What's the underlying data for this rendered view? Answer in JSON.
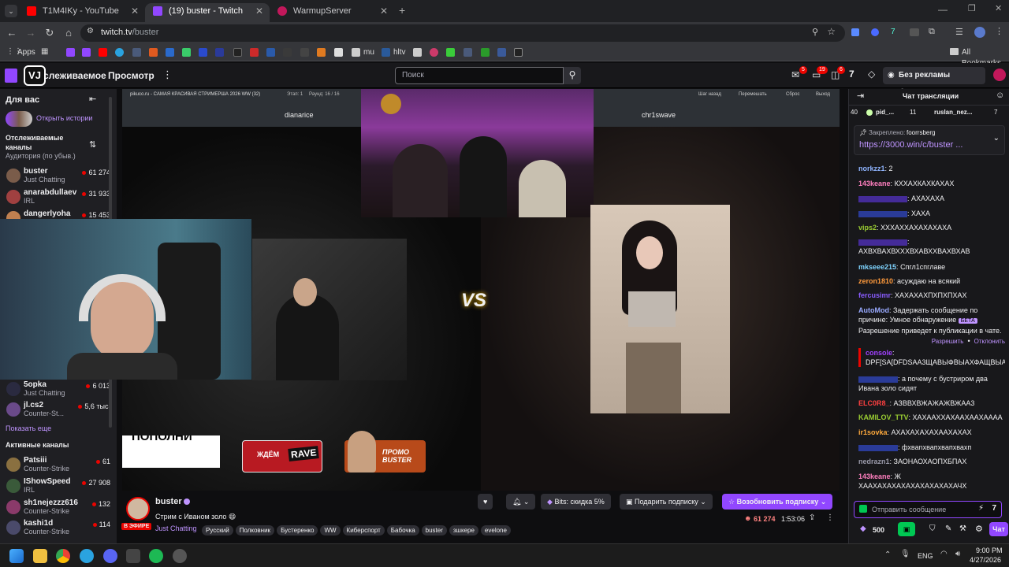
{
  "browser": {
    "tabs": [
      {
        "title": "T1M4IKy - YouTube",
        "active": false,
        "color": "#ff0000"
      },
      {
        "title": "(19) buster - Twitch",
        "active": true,
        "color": "#9147ff"
      },
      {
        "title": "WarmupServer",
        "active": false,
        "color": "#c2185b"
      }
    ],
    "url_host": "twitch.tv",
    "url_path": "/buster",
    "bookmarks": {
      "apps": "Apps",
      "mu": "mu",
      "hltv": "hltv",
      "all_bookmarks": "All Bookmarks"
    }
  },
  "twitch_nav": {
    "following": "Отслеживаемое",
    "browse": "Просмотр",
    "search_placeholder": "Поиск",
    "badges": {
      "inbox": "5",
      "whispers": "19",
      "notifications": "6"
    },
    "ad_free": "Без рекламы бесплатно",
    "logo_text": "VJ"
  },
  "sidebar": {
    "for_you": "Для вас",
    "open_stories": "Открыть истории",
    "followed_title": "Отслеживаемые каналы",
    "sort_label": "Аудитория (по убыв.)",
    "followed": [
      {
        "name": "buster",
        "category": "Just Chatting",
        "viewers": "61 274",
        "color": "#7a5c4a"
      },
      {
        "name": "anarabdullaev",
        "category": "IRL",
        "viewers": "31 933",
        "color": "#a04040"
      },
      {
        "name": "dangerlyoha",
        "category": "",
        "viewers": "15 453",
        "color": "#c08050"
      },
      {
        "name": "5opka",
        "category": "Just Chatting",
        "viewers": "6 013",
        "color": "#2a2a40"
      },
      {
        "name": "jl.cs2",
        "category": "Counter-St...",
        "viewers": "5,6 тыс.",
        "color": "#6a4a8a"
      }
    ],
    "show_more": "Показать еще",
    "active_title": "Активные каналы",
    "active": [
      {
        "name": "Patsiii",
        "category": "Counter-Strike",
        "viewers": "61",
        "color": "#8a7040"
      },
      {
        "name": "IShowSpeed",
        "category": "IRL",
        "viewers": "27 908",
        "color": "#3a5a3a"
      },
      {
        "name": "sh1nejezzz616",
        "category": "Counter-Strike",
        "viewers": "132",
        "color": "#8a3a6a"
      },
      {
        "name": "kashi1d",
        "category": "Counter-Strike",
        "viewers": "114",
        "color": "#4a4a6a"
      }
    ]
  },
  "video": {
    "site_title": "pikuco.ru - САМАЯ КРАСИВАЯ СТРИМЕРША 2026 WW (32)",
    "stage": "Этап: 1",
    "round": "Раунд: 16 / 16",
    "controls": [
      "Шаг назад",
      "Перемешать",
      "Сброс",
      "Выход"
    ],
    "left_name": "dianarice",
    "right_name": "chr1swave",
    "vs": "VS",
    "promo_wait": "ЖДЁМ",
    "promo_rave": "RAVE",
    "promo_buster": "ПРОМО BUSTER",
    "white_sign": "ПОПОЛНИ"
  },
  "stream": {
    "channel": "buster",
    "title": "Стрим с Иваном золо 😄",
    "category": "Just Chatting",
    "live_badge": "В ЭФИРЕ",
    "tags": [
      "Русский",
      "Полковник",
      "Бустеренко",
      "WW",
      "Киберспорт",
      "Бабочка",
      "buster",
      "зшкере",
      "evelone"
    ],
    "bits_label": "Bits: скидка 5%",
    "gift_sub": "Подарить подписку",
    "resub": "Возобновить подписку",
    "viewers": "61 274",
    "uptime": "1:53:06"
  },
  "chat": {
    "header": "Чат трансляции",
    "leaderboard": [
      {
        "rank": "40",
        "name": "pid_..."
      },
      {
        "count": "11",
        "name": "ruslan_nez..."
      },
      {
        "count": "7"
      }
    ],
    "pinned_label": "Закреплено:",
    "pinned_user": "foorrsberg",
    "pinned_link": "https://3000.win/c/buster ...",
    "messages": [
      {
        "user": "norkzz1",
        "text": "2",
        "color": "#8fb4ff"
      },
      {
        "user": "143keane",
        "text": "КХХАХКАХКАХАХ",
        "color": "#ff7fbf"
      },
      {
        "user": "",
        "text": "АХАХАХА",
        "color": "#6a3cff"
      },
      {
        "user": "",
        "text": "ХАХА",
        "color": "#3a5aff"
      },
      {
        "user": "vips2",
        "text": "ХХХАХХАХАХАХАХА",
        "color": "#9acd32"
      },
      {
        "user": "",
        "text": "АХВХВАХВХХХВХАВХХВАХВХАВ",
        "color": "#6a3cff"
      },
      {
        "user": "mkseee215",
        "text": "Спгл1спглаве",
        "color": "#7fd4ff"
      },
      {
        "user": "zeron1810",
        "text": "асуждаю на всякий",
        "color": "#ff9a3c"
      },
      {
        "user": "fercusimr",
        "text": "ХАХАХАХПХПХПХАХ",
        "color": "#8a5cff"
      }
    ],
    "automod": {
      "user": "AutoMod",
      "text": "Задержать сообщение по причине: Умное обнаружение",
      "beta": "БЕТА",
      "text2": "Разрешение приведет к публикации в чате.",
      "allow": "Разрешить",
      "deny": "Отклонить",
      "held_user": "console",
      "held_text": "DPF[SA[DFDSAA3ЩАВЫФВЫАХФАЩВЫАФФ"
    },
    "messages2": [
      {
        "user": "",
        "text": "а почему с бустриром два Ивана золо сидят",
        "color": "#3a5aff"
      },
      {
        "user": "ELC0R8_",
        "text": "АЗВВХВЖАЖАЖВЖАА3",
        "color": "#ff4040"
      },
      {
        "user": "KAMILOV_TTV",
        "text": "ХАХААХХАХААХААХАААА",
        "color": "#9acd32"
      },
      {
        "user": "ir1sovka",
        "text": "АХАХАХАХАХААХАХАХ",
        "color": "#ffaa3c"
      },
      {
        "user": "",
        "text": "фхваnхвапхвапхвахп",
        "color": "#3a5aff"
      },
      {
        "user": "nedrazn1",
        "text": "ЗАОНАОХАОПХБПАХ",
        "color": "#9a9aaa"
      },
      {
        "user": "143keane",
        "text": "Ж ХААХАХАХАХАХАХАХАХАХАЧХ",
        "color": "#ff7fbf"
      }
    ],
    "input_placeholder": "Отправить сообщение",
    "points": "500",
    "chat_button": "Чат"
  },
  "taskbar": {
    "lang": "ENG",
    "time": "9:00 PM",
    "date": "4/27/2026"
  }
}
